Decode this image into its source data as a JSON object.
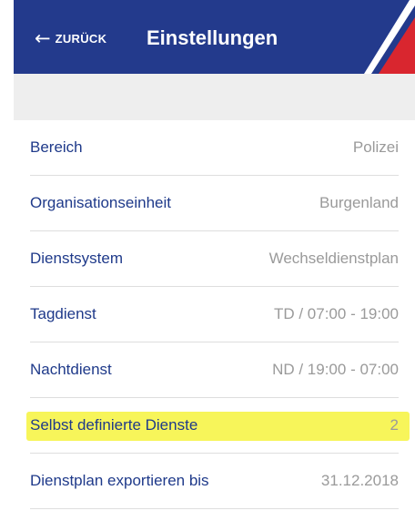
{
  "header": {
    "back_arrow": "←",
    "back_label": "ZURÜCK",
    "title": "Einstellungen",
    "color": "#233a8c",
    "stripe_colors": [
      "#ffffff",
      "#d9262f"
    ]
  },
  "settings": [
    {
      "label": "Bereich",
      "value": "Polizei"
    },
    {
      "label": "Organisationseinheit",
      "value": "Burgenland"
    },
    {
      "label": "Dienstsystem",
      "value": "Wechseldienstplan"
    },
    {
      "label": "Tagdienst",
      "value": "TD / 07:00 - 19:00"
    },
    {
      "label": "Nachtdienst",
      "value": "ND / 19:00 - 07:00"
    },
    {
      "label": "Selbst definierte Dienste",
      "value": "2",
      "highlighted": true
    },
    {
      "label": "Dienstplan exportieren bis",
      "value": "31.12.2018"
    }
  ],
  "colors": {
    "label": "#1f3a8a",
    "value": "#9a9a9a",
    "highlight": "#f7f55a",
    "spacer": "#eeeeee"
  }
}
